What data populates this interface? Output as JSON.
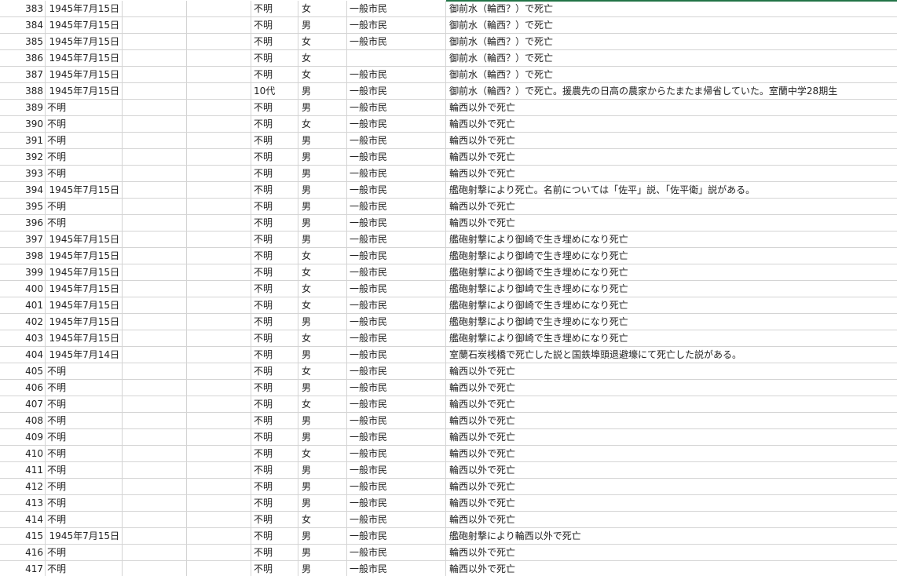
{
  "sheet": {
    "accent_color": "#217346",
    "rows": [
      {
        "no": "383",
        "date": "1945年7月15日",
        "age": "不明",
        "sex": "女",
        "category": "一般市民",
        "note": "御前水（輪西？）で死亡"
      },
      {
        "no": "384",
        "date": "1945年7月15日",
        "age": "不明",
        "sex": "男",
        "category": "一般市民",
        "note": "御前水（輪西？）で死亡"
      },
      {
        "no": "385",
        "date": "1945年7月15日",
        "age": "不明",
        "sex": "女",
        "category": "一般市民",
        "note": "御前水（輪西？）で死亡"
      },
      {
        "no": "386",
        "date": "1945年7月15日",
        "age": "不明",
        "sex": "女",
        "category": "",
        "note": "御前水（輪西？）で死亡"
      },
      {
        "no": "387",
        "date": "1945年7月15日",
        "age": "不明",
        "sex": "女",
        "category": "一般市民",
        "note": "御前水（輪西？）で死亡"
      },
      {
        "no": "388",
        "date": "1945年7月15日",
        "age": "10代",
        "sex": "男",
        "category": "一般市民",
        "note": "御前水（輪西？）で死亡。援農先の日高の農家からたまたま帰省していた。室蘭中学28期生"
      },
      {
        "no": "389",
        "date": "不明",
        "age": "不明",
        "sex": "男",
        "category": "一般市民",
        "note": "輪西以外で死亡"
      },
      {
        "no": "390",
        "date": "不明",
        "age": "不明",
        "sex": "女",
        "category": "一般市民",
        "note": "輪西以外で死亡"
      },
      {
        "no": "391",
        "date": "不明",
        "age": "不明",
        "sex": "男",
        "category": "一般市民",
        "note": "輪西以外で死亡"
      },
      {
        "no": "392",
        "date": "不明",
        "age": "不明",
        "sex": "男",
        "category": "一般市民",
        "note": "輪西以外で死亡"
      },
      {
        "no": "393",
        "date": "不明",
        "age": "不明",
        "sex": "男",
        "category": "一般市民",
        "note": "輪西以外で死亡"
      },
      {
        "no": "394",
        "date": "1945年7月15日",
        "age": "不明",
        "sex": "男",
        "category": "一般市民",
        "note": "艦砲射撃により死亡。名前については「佐平」説、「佐平衛」説がある。"
      },
      {
        "no": "395",
        "date": "不明",
        "age": "不明",
        "sex": "男",
        "category": "一般市民",
        "note": "輪西以外で死亡"
      },
      {
        "no": "396",
        "date": "不明",
        "age": "不明",
        "sex": "男",
        "category": "一般市民",
        "note": "輪西以外で死亡"
      },
      {
        "no": "397",
        "date": "1945年7月15日",
        "age": "不明",
        "sex": "男",
        "category": "一般市民",
        "note": "艦砲射撃により御崎で生き埋めになり死亡"
      },
      {
        "no": "398",
        "date": "1945年7月15日",
        "age": "不明",
        "sex": "女",
        "category": "一般市民",
        "note": "艦砲射撃により御崎で生き埋めになり死亡"
      },
      {
        "no": "399",
        "date": "1945年7月15日",
        "age": "不明",
        "sex": "女",
        "category": "一般市民",
        "note": "艦砲射撃により御崎で生き埋めになり死亡"
      },
      {
        "no": "400",
        "date": "1945年7月15日",
        "age": "不明",
        "sex": "女",
        "category": "一般市民",
        "note": "艦砲射撃により御崎で生き埋めになり死亡"
      },
      {
        "no": "401",
        "date": "1945年7月15日",
        "age": "不明",
        "sex": "女",
        "category": "一般市民",
        "note": "艦砲射撃により御崎で生き埋めになり死亡"
      },
      {
        "no": "402",
        "date": "1945年7月15日",
        "age": "不明",
        "sex": "男",
        "category": "一般市民",
        "note": "艦砲射撃により御崎で生き埋めになり死亡"
      },
      {
        "no": "403",
        "date": "1945年7月15日",
        "age": "不明",
        "sex": "女",
        "category": "一般市民",
        "note": "艦砲射撃により御崎で生き埋めになり死亡"
      },
      {
        "no": "404",
        "date": "1945年7月14日",
        "age": "不明",
        "sex": "男",
        "category": "一般市民",
        "note": "室蘭石炭桟橋で死亡した説と国鉄埠頭退避壕にて死亡した説がある。"
      },
      {
        "no": "405",
        "date": "不明",
        "age": "不明",
        "sex": "女",
        "category": "一般市民",
        "note": "輪西以外で死亡"
      },
      {
        "no": "406",
        "date": "不明",
        "age": "不明",
        "sex": "男",
        "category": "一般市民",
        "note": "輪西以外で死亡"
      },
      {
        "no": "407",
        "date": "不明",
        "age": "不明",
        "sex": "女",
        "category": "一般市民",
        "note": "輪西以外で死亡"
      },
      {
        "no": "408",
        "date": "不明",
        "age": "不明",
        "sex": "男",
        "category": "一般市民",
        "note": "輪西以外で死亡"
      },
      {
        "no": "409",
        "date": "不明",
        "age": "不明",
        "sex": "男",
        "category": "一般市民",
        "note": "輪西以外で死亡"
      },
      {
        "no": "410",
        "date": "不明",
        "age": "不明",
        "sex": "女",
        "category": "一般市民",
        "note": "輪西以外で死亡"
      },
      {
        "no": "411",
        "date": "不明",
        "age": "不明",
        "sex": "男",
        "category": "一般市民",
        "note": "輪西以外で死亡"
      },
      {
        "no": "412",
        "date": "不明",
        "age": "不明",
        "sex": "男",
        "category": "一般市民",
        "note": "輪西以外で死亡"
      },
      {
        "no": "413",
        "date": "不明",
        "age": "不明",
        "sex": "男",
        "category": "一般市民",
        "note": "輪西以外で死亡"
      },
      {
        "no": "414",
        "date": "不明",
        "age": "不明",
        "sex": "女",
        "category": "一般市民",
        "note": "輪西以外で死亡"
      },
      {
        "no": "415",
        "date": "1945年7月15日",
        "age": "不明",
        "sex": "男",
        "category": "一般市民",
        "note": "艦砲射撃により輪西以外で死亡"
      },
      {
        "no": "416",
        "date": "不明",
        "age": "不明",
        "sex": "男",
        "category": "一般市民",
        "note": "輪西以外で死亡"
      },
      {
        "no": "417",
        "date": "不明",
        "age": "不明",
        "sex": "男",
        "category": "一般市民",
        "note": "輪西以外で死亡"
      }
    ]
  }
}
